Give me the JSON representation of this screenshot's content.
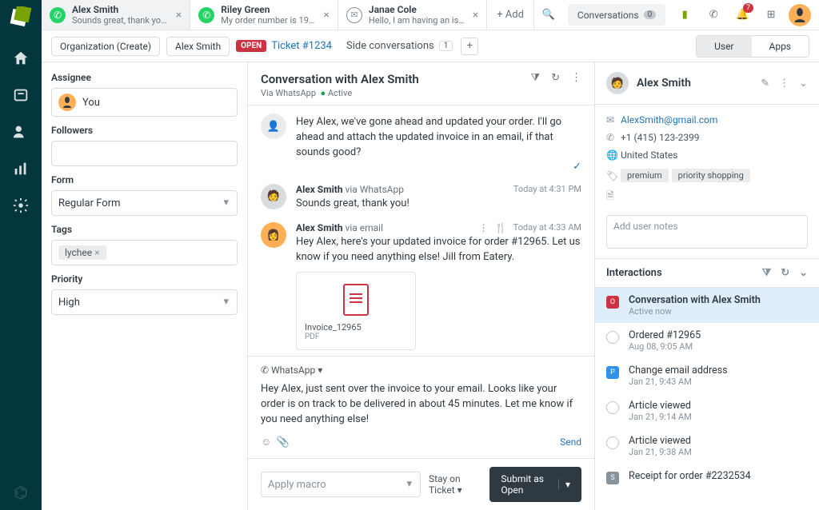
{
  "tabs": [
    {
      "channel": "wa",
      "title": "Alex Smith",
      "sub": "Sounds great, thank you!"
    },
    {
      "channel": "wa",
      "title": "Riley Green",
      "sub": "My order number is 19..."
    },
    {
      "channel": "em",
      "title": "Janae Cole",
      "sub": "Hello, I am having an is..."
    }
  ],
  "add_tab": "+ Add",
  "conversations_btn": {
    "label": "Conversations",
    "count": "0"
  },
  "notif_count": "7",
  "breadcrumb": {
    "org": "Organization (Create)",
    "user": "Alex Smith",
    "open": "OPEN",
    "ticket": "Ticket #1234",
    "side": "Side conversations",
    "side_count": "1"
  },
  "segments": {
    "user": "User",
    "apps": "Apps"
  },
  "left": {
    "assignee_label": "Assignee",
    "assignee_value": "You",
    "followers_label": "Followers",
    "form_label": "Form",
    "form_value": "Regular Form",
    "tags_label": "Tags",
    "tag": "lychee",
    "priority_label": "Priority",
    "priority_value": "High"
  },
  "mid": {
    "title": "Conversation with Alex Smith",
    "via": "Via WhatsApp",
    "status": "Active",
    "msg0": "Hey Alex, we've gone ahead and updated your order. I'll go ahead and attach the updated invoice in an email, if that sounds good?",
    "from1": "Alex Smith",
    "via1": "via WhatsApp",
    "time1": "Today at 4:31 PM",
    "body1": "Sounds great, thank you!",
    "from2": "Alex Smith",
    "via2": "via email",
    "time2": "Today at 4:33 AM",
    "body2": "Hey Alex, here's your updated invoice for order #12965. Let us know if you need anything else! Jill from Eatery.",
    "att_name": "Invoice_12965",
    "att_type": "PDF",
    "compose_channel": "WhatsApp",
    "draft": "Hey Alex, just sent over the invoice to your email. Looks like your order is on track to be delivered in about 45 minutes. Let me know if you need anything else!",
    "send": "Send",
    "macro_placeholder": "Apply macro",
    "stay": "Stay on Ticket",
    "submit": "Submit as Open"
  },
  "right": {
    "name": "Alex Smith",
    "email": "AlexSmith@gmail.com",
    "phone": "+1 (415) 123-2399",
    "country": "United States",
    "tag1": "premium",
    "tag2": "priority shopping",
    "notes_placeholder": "Add user notes",
    "ix_title": "Interactions",
    "items": [
      {
        "m": "o",
        "t": "Conversation with Alex Smith",
        "s": "Active now"
      },
      {
        "m": "c",
        "t": "Ordered #12965",
        "s": "Aug 08, 9:05 AM"
      },
      {
        "m": "p",
        "t": "Change email address",
        "s": "Jan 21, 9:43 AM"
      },
      {
        "m": "c",
        "t": "Article viewed",
        "s": "Jan 21, 9:14 AM"
      },
      {
        "m": "c",
        "t": "Article viewed",
        "s": "Jan 21, 9:38 AM"
      },
      {
        "m": "s",
        "t": "Receipt for order #2232534",
        "s": ""
      }
    ]
  }
}
